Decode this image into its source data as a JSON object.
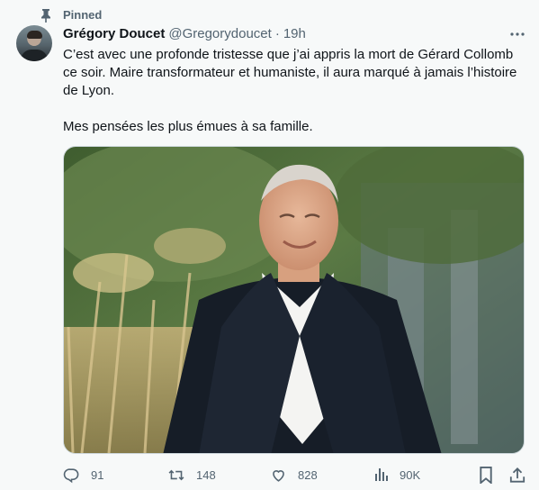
{
  "pinned": {
    "label": "Pinned",
    "icon": "pin-icon"
  },
  "author": {
    "name": "Grégory Doucet",
    "handle": "@Gregorydoucet",
    "separator": "·",
    "time": "19h"
  },
  "tweet": {
    "paragraphs": [
      "C’est avec une profonde tristesse que j’ai appris la mort de Gérard Collomb ce soir. Maire transformateur et humaniste, il aura marqué à jamais l’histoire de Lyon.",
      "Mes pensées les plus émues à sa famille."
    ]
  },
  "media": {
    "type": "photo"
  },
  "actions": {
    "reply": {
      "icon": "reply-icon",
      "count": "91"
    },
    "retweet": {
      "icon": "retweet-icon",
      "count": "148"
    },
    "like": {
      "icon": "heart-icon",
      "count": "828"
    },
    "views": {
      "icon": "views-icon",
      "count": "90K"
    },
    "bookmark": {
      "icon": "bookmark-icon"
    },
    "share": {
      "icon": "share-icon"
    }
  },
  "colors": {
    "background": "#f7f9f9",
    "text": "#0f1419",
    "secondary": "#536471",
    "border": "#cfd9de"
  }
}
